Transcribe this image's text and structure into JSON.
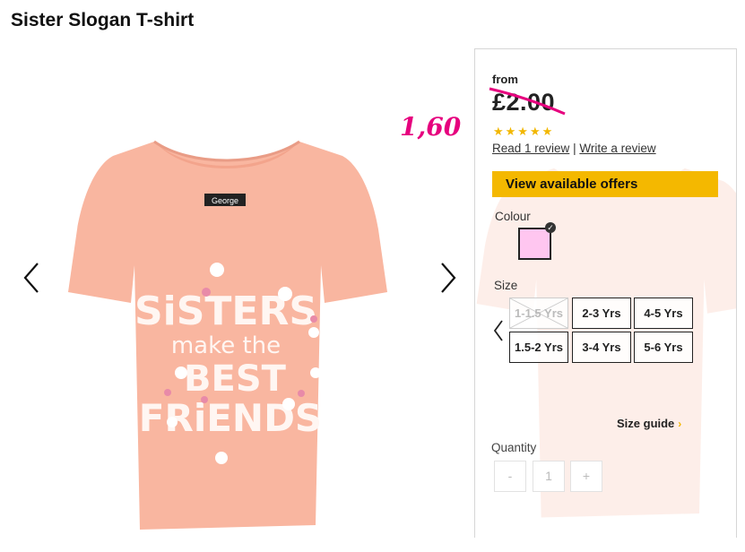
{
  "product": {
    "title": "Sister Slogan T-shirt",
    "shirt_brand_label": "George",
    "shirt_slogan_lines": [
      "SiSTERS",
      "make the",
      "BEST",
      "FRiENDS"
    ],
    "handwritten_price_note": "1,60"
  },
  "pricing": {
    "from_label": "from",
    "price": "£2.00",
    "rating_stars": "★★★★★",
    "rating_value": 5,
    "read_reviews_link": "Read 1 review",
    "separator": "|",
    "write_review_link": "Write a review"
  },
  "offers_button": "View available offers",
  "colour": {
    "label": "Colour",
    "selected_hex": "#ffc6f0"
  },
  "size": {
    "label": "Size",
    "options_row1": [
      "1-1.5 Yrs",
      "2-3 Yrs",
      "4-5 Yrs"
    ],
    "options_row2": [
      "1.5-2 Yrs",
      "3-4 Yrs",
      "5-6 Yrs"
    ],
    "unavailable": [
      "1-1.5 Yrs"
    ],
    "size_guide_link": "Size guide"
  },
  "quantity": {
    "label": "Quantity",
    "decrement": "-",
    "value": "1",
    "increment": "+"
  },
  "colors": {
    "accent_yellow": "#f4b800",
    "shirt_peach": "#f9b6a0",
    "handwriting_pink": "#e6007e"
  },
  "icons": {
    "prev": "chevron-left-icon",
    "next": "chevron-right-icon",
    "size_guide": "chevron-right-icon",
    "swatch_selected": "check-icon"
  }
}
